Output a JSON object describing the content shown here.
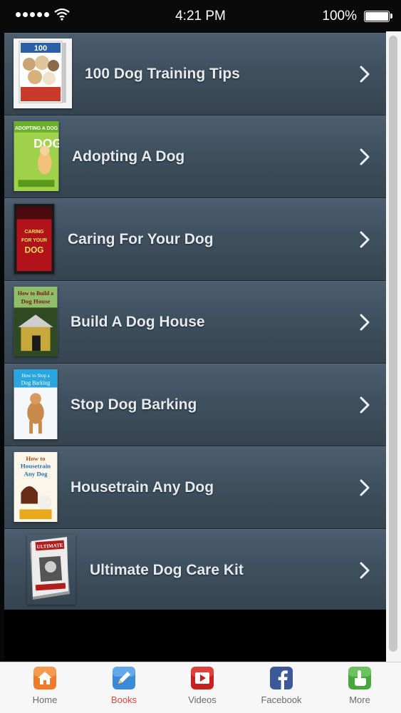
{
  "status_bar": {
    "time": "4:21 PM",
    "battery": "100%"
  },
  "list": {
    "items": [
      {
        "title": "100 Dog Training Tips",
        "cover_label": "100"
      },
      {
        "title": "Adopting A Dog",
        "cover_label": "ADOPTING A DOG"
      },
      {
        "title": "Caring For Your Dog",
        "cover_label": "CARING FOR YOUR DOG"
      },
      {
        "title": "Build A Dog House",
        "cover_label": "How to Build a Dog House"
      },
      {
        "title": "Stop Dog Barking",
        "cover_label": "How to Stop a Dog Barking"
      },
      {
        "title": "Housetrain Any Dog",
        "cover_label": "How to Housetrain Any Dog"
      },
      {
        "title": "Ultimate Dog Care Kit",
        "cover_label": "ULTIMATE"
      }
    ]
  },
  "tabbar": {
    "home": "Home",
    "books": "Books",
    "videos": "Videos",
    "facebook": "Facebook",
    "more": "More"
  },
  "colors": {
    "row_top": "#4c5e6f",
    "row_bottom": "#35444f",
    "active_tab": "#e0443a"
  }
}
